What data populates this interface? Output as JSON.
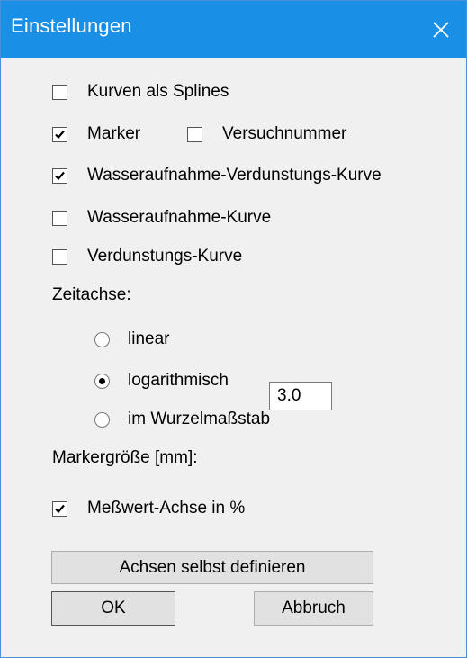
{
  "window": {
    "title": "Einstellungen",
    "close_icon": "close-icon",
    "titlebar_color": "#1a8fe6"
  },
  "options": {
    "splines": {
      "label": "Kurven als Splines",
      "checked": false
    },
    "marker": {
      "label": "Marker",
      "checked": true
    },
    "trial_number": {
      "label": "Versuchnummer",
      "checked": false
    },
    "water_evap_curve": {
      "label": "Wasseraufnahme-Verdunstungs-Kurve",
      "checked": true
    },
    "water_curve": {
      "label": "Wasseraufnahme-Kurve",
      "checked": false
    },
    "evap_curve": {
      "label": "Verdunstungs-Kurve",
      "checked": false
    }
  },
  "time_axis": {
    "label": "Zeitachse:",
    "options": [
      {
        "label": "linear",
        "selected": false
      },
      {
        "label": "logarithmisch",
        "selected": true
      },
      {
        "label": "im Wurzelmaßstab",
        "selected": false
      }
    ]
  },
  "marker_size": {
    "label": "Markergröße [mm]:",
    "value": "3.0"
  },
  "percent_axis": {
    "label": "Meßwert-Achse in %",
    "checked": true
  },
  "buttons": {
    "define_axes": "Achsen selbst definieren",
    "ok": "OK",
    "cancel": "Abbruch"
  }
}
